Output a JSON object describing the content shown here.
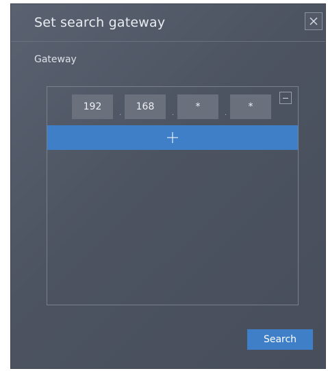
{
  "dialog": {
    "title": "Set search gateway",
    "close_icon": "close-icon"
  },
  "gateway": {
    "label": "Gateway",
    "entries": [
      {
        "octets": [
          "192",
          "168",
          "*",
          "*"
        ]
      }
    ],
    "remove_icon": "minus-icon",
    "add_icon": "plus-icon"
  },
  "actions": {
    "search_label": "Search"
  },
  "colors": {
    "accent": "#3e7fc7",
    "background": "#4c5361",
    "field": "#6a717d"
  }
}
